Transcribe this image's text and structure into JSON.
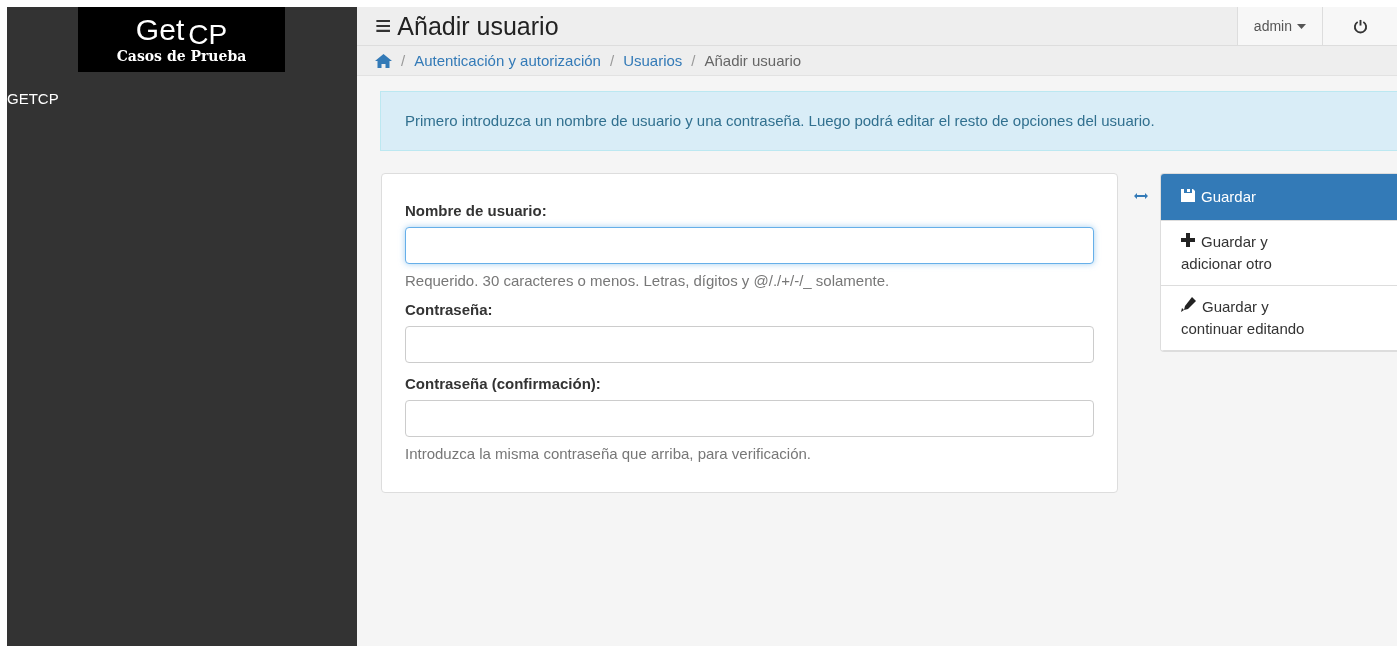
{
  "sidebar": {
    "logo": {
      "title": "Get",
      "title_suffix": "CP",
      "subtitle": "Casos de Prueba"
    },
    "items": [
      {
        "label": "GETCP"
      }
    ]
  },
  "header": {
    "menu_icon": "≡",
    "title": "Añadir usuario",
    "user": "admin"
  },
  "breadcrumb": [
    {
      "separator": "/",
      "label": "Autenticación y autorización",
      "link": true
    },
    {
      "separator": "/",
      "label": "Usuarios",
      "link": true
    },
    {
      "separator": "/",
      "label": "Añadir usuario",
      "link": false
    }
  ],
  "alert": "Primero introduzca un nombre de usuario y una contraseña. Luego podrá editar el resto de opciones del usuario.",
  "form": {
    "fields": [
      {
        "label": "Nombre de usuario:",
        "focused": true,
        "help": "Requerido. 30 caracteres o menos. Letras, dígitos y @/./+/-/_ solamente."
      },
      {
        "label": "Contraseña:",
        "focused": false
      },
      {
        "label": "Contraseña (confirmación):",
        "focused": false,
        "help": "Introduzca la misma contraseña que arriba, para verificación."
      }
    ]
  },
  "actions": [
    {
      "kind": "save",
      "label": "Guardar",
      "primary": true
    },
    {
      "kind": "add",
      "label": "Guardar y adicionar otro",
      "primary": false
    },
    {
      "kind": "edit",
      "label": "Guardar y continuar editando",
      "primary": false
    }
  ]
}
